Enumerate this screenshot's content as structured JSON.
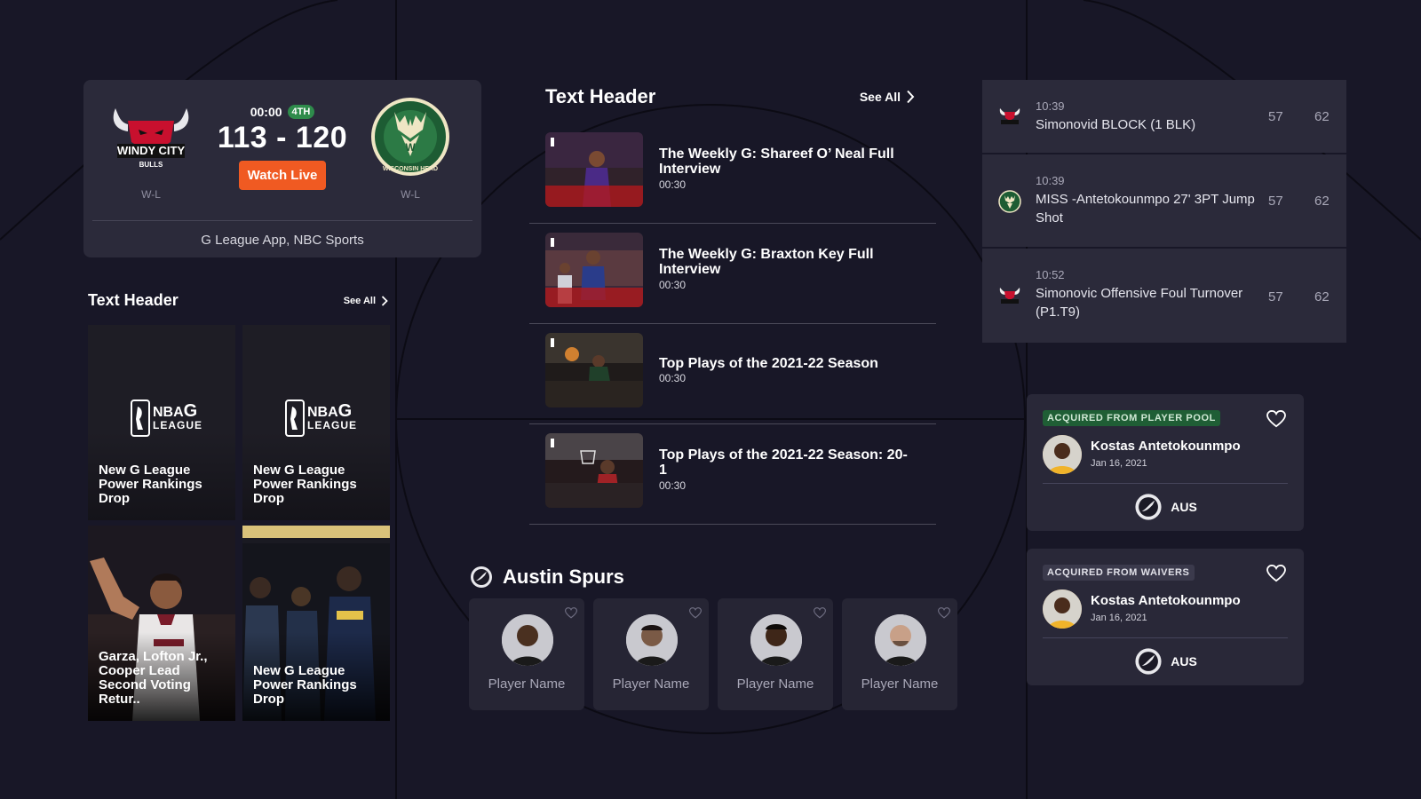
{
  "colors": {
    "background": "#181727",
    "card": "#2b2a3a",
    "accent_orange": "#f05a22",
    "quarter_green": "#2e8b4b",
    "player_pool_badge": "#1f5e35",
    "waivers_badge": "#3b3a4c"
  },
  "game": {
    "clock": "00:00",
    "quarter": "4TH",
    "score": "113 - 120",
    "watch_label": "Watch Live",
    "broadcast": "G League App, NBC Sports",
    "home": {
      "logo_icon": "windy-city-bulls-logo",
      "logo_text_top": "WINDY CITY",
      "logo_text_bottom": "BULLS",
      "record": "W-L"
    },
    "away": {
      "logo_icon": "wisconsin-herd-logo",
      "logo_text": "WISCONSIN HERD",
      "record": "W-L"
    }
  },
  "news": {
    "header": "Text Header",
    "see_all": "See All",
    "logo_text_nba": "NBA",
    "logo_text_g": "G",
    "logo_text_league": "LEAGUE",
    "tiles": [
      {
        "title": "New G League Power Rankings Drop"
      },
      {
        "title": "New G League Power Rankings Drop"
      },
      {
        "title": "Garza, Lofton Jr., Cooper Lead Second Voting Retur.."
      },
      {
        "title": "New G League Power Rankings Drop"
      }
    ]
  },
  "videos": {
    "header": "Text Header",
    "see_all": "See All",
    "items": [
      {
        "title": "The Weekly G: Shareef O’ Neal Full Interview",
        "duration": "00:30"
      },
      {
        "title": "The Weekly G: Braxton Key Full Interview",
        "duration": "00:30"
      },
      {
        "title": "Top Plays of the 2021-22 Season",
        "duration": "00:30"
      },
      {
        "title": "Top Plays of the 2021-22 Season: 20-1",
        "duration": "00:30"
      }
    ]
  },
  "plays": [
    {
      "time": "10:39",
      "description": "Simonovid BLOCK (1 BLK)",
      "home_score": "57",
      "away_score": "62",
      "team_icon": "bulls-icon"
    },
    {
      "time": "10:39",
      "description": "MISS -Antetokounmpo 27' 3PT Jump Shot",
      "home_score": "57",
      "away_score": "62",
      "team_icon": "herd-icon"
    },
    {
      "time": "10:52",
      "description": "Simonovic Offensive Foul Turnover (P1.T9)",
      "home_score": "57",
      "away_score": "62",
      "team_icon": "bulls-icon"
    }
  ],
  "roster": {
    "team_name": "Austin Spurs",
    "players": [
      {
        "name": "Player Name"
      },
      {
        "name": "Player Name"
      },
      {
        "name": "Player Name"
      },
      {
        "name": "Player Name"
      }
    ]
  },
  "transactions": [
    {
      "badge": "ACQUIRED FROM PLAYER POOL",
      "player": "Kostas Antetokounmpo",
      "date": "Jan 16, 2021",
      "team": "AUS"
    },
    {
      "badge": "ACQUIRED FROM WAIVERS",
      "player": "Kostas Antetokounmpo",
      "date": "Jan 16, 2021",
      "team": "AUS"
    }
  ]
}
